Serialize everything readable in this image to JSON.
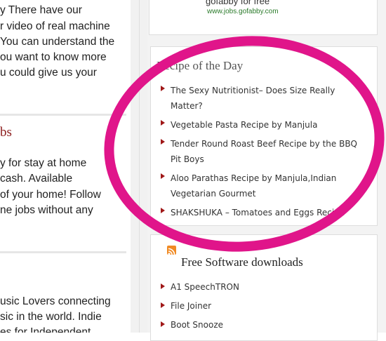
{
  "left": {
    "lines_a": [
      "y There have our",
      "r video of real machine",
      "You can understand the",
      "ou want to know more",
      "u could give us your"
    ],
    "heading": "bs",
    "lines_b": [
      "y for stay at home",
      "cash. Available",
      "of your home! Follow",
      "ne jobs without any"
    ],
    "lines_c": [
      "usic Lovers connecting",
      "sic in the world. Indie",
      "es for Independent"
    ]
  },
  "ad": {
    "title": "gofabby for free",
    "url": "www.jobs.gofabby.com"
  },
  "recipe_widget": {
    "title": "Recipe of the Day",
    "items": [
      {
        "line1": "The Sexy Nutritionist– Does Size Really",
        "line2": "Matter?"
      },
      {
        "line1": "Vegetable Pasta Recipe by Manjula",
        "line2": ""
      },
      {
        "line1": "Tender Round Roast Beef Recipe by the BBQ",
        "line2": "Pit Boys"
      },
      {
        "line1": "Aloo Parathas Recipe by Manjula,Indian",
        "line2": "Vegetarian Gourmet"
      },
      {
        "line1": "SHAKSHUKA – Tomatoes and Eggs Recipe",
        "line2": ""
      }
    ]
  },
  "software_widget": {
    "title": "Free Software downloads",
    "items": [
      "A1 SpeechTRON",
      "File Joiner",
      "Boot Snooze"
    ]
  },
  "colors": {
    "highlight_circle": "#e0158a",
    "heading_red": "#8b1a1a",
    "bullet": "#a01818"
  }
}
